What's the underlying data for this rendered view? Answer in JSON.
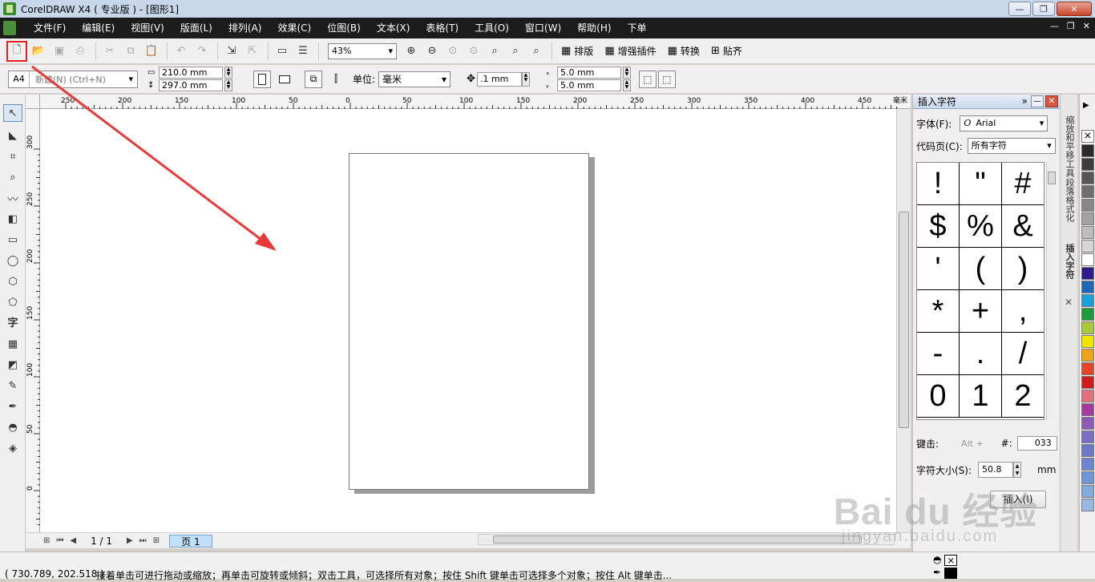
{
  "window": {
    "title": "CorelDRAW X4 ( 专业版 ) - [图形1]",
    "btn_minimize": "—",
    "btn_restore": "❐",
    "btn_close": "✕"
  },
  "menubar": {
    "items": [
      "文件(F)",
      "编辑(E)",
      "视图(V)",
      "版面(L)",
      "排列(A)",
      "效果(C)",
      "位图(B)",
      "文本(X)",
      "表格(T)",
      "工具(O)",
      "窗口(W)",
      "帮助(H)",
      "下单"
    ],
    "mdi_minimize": "—",
    "mdi_restore": "❐",
    "mdi_close": "✕"
  },
  "toolbar": {
    "zoom": "43%",
    "btn_layout": "排版",
    "btn_plugins": "增强插件",
    "btn_convert": "转换",
    "btn_align": "贴齐"
  },
  "tooltip": "新建(N) (Ctrl+N)",
  "propertybar": {
    "page_size": "A4",
    "width": "210.0 mm",
    "height": "297.0 mm",
    "units_label": "单位:",
    "units": "毫米",
    "nudge": ".1 mm",
    "dup_x": "5.0 mm",
    "dup_y": "5.0 mm"
  },
  "ruler": {
    "top_ticks": [
      "250",
      "200",
      "150",
      "100",
      "50",
      "0",
      "50",
      "100",
      "150",
      "200",
      "250",
      "300",
      "350",
      "400",
      "450"
    ],
    "top_unit": "毫米",
    "left_ticks": [
      "300",
      "250",
      "200",
      "150",
      "100",
      "50",
      "0"
    ]
  },
  "pagebar": {
    "count": "1 / 1",
    "page_tab": "页 1"
  },
  "statusbar": {
    "coords": "( 730.789, 202.518 )",
    "hint": "接着单击可进行拖动或缩放；再单击可旋转或倾斜；双击工具，可选择所有对象；按住 Shift 键单击可选择多个对象；按住 Alt 键单击..."
  },
  "docker": {
    "title": "插入字符",
    "expand": "»",
    "btn_minimize": "—",
    "btn_close": "✕",
    "font_label": "字体(F):",
    "font_value": "Arial",
    "codepage_label": "代码页(C):",
    "codepage_value": "所有字符",
    "glyphs": [
      "!",
      "\"",
      "#",
      "$",
      "%",
      "&",
      "'",
      "(",
      ")",
      "*",
      "+",
      ",",
      "-",
      ".",
      "/",
      "0",
      "1",
      "2"
    ],
    "keystroke_label": "键击:",
    "alt_hint": "Alt +",
    "hash": "#:",
    "code": "033",
    "charsize_label": "字符大小(S):",
    "charsize_value": "50.8",
    "charsize_unit": "mm",
    "insert_btn": "插入(I)"
  },
  "docker_tabs": [
    "缩放和平移工具",
    "段落格式化",
    "插入字符"
  ],
  "docker_tab_close": "✕",
  "palette": [
    "#2a2a2a",
    "#3d3d3d",
    "#565656",
    "#6e6e6e",
    "#878787",
    "#a1a1a1",
    "#bcbcbc",
    "#d6d6d6",
    "#ffffff",
    "#2e1a8a",
    "#1f67b8",
    "#1a9fd8",
    "#1f9a3c",
    "#a8c93a",
    "#f2e600",
    "#f0a41a",
    "#e4452a",
    "#cf1b1b",
    "#e0707a",
    "#a33a9c",
    "#8d5bb3",
    "#7a6fc2",
    "#6d79c8",
    "#6a86cf",
    "#6f96d6",
    "#83aadd",
    "#98b8e2"
  ],
  "watermark": {
    "brand": "Bai du 经验",
    "url": "jingyan.baidu.com"
  },
  "colors": {
    "annotation": "#e83a3a",
    "menubar_bg": "#1c1c1c",
    "page_tab": "#bfe0f8"
  }
}
